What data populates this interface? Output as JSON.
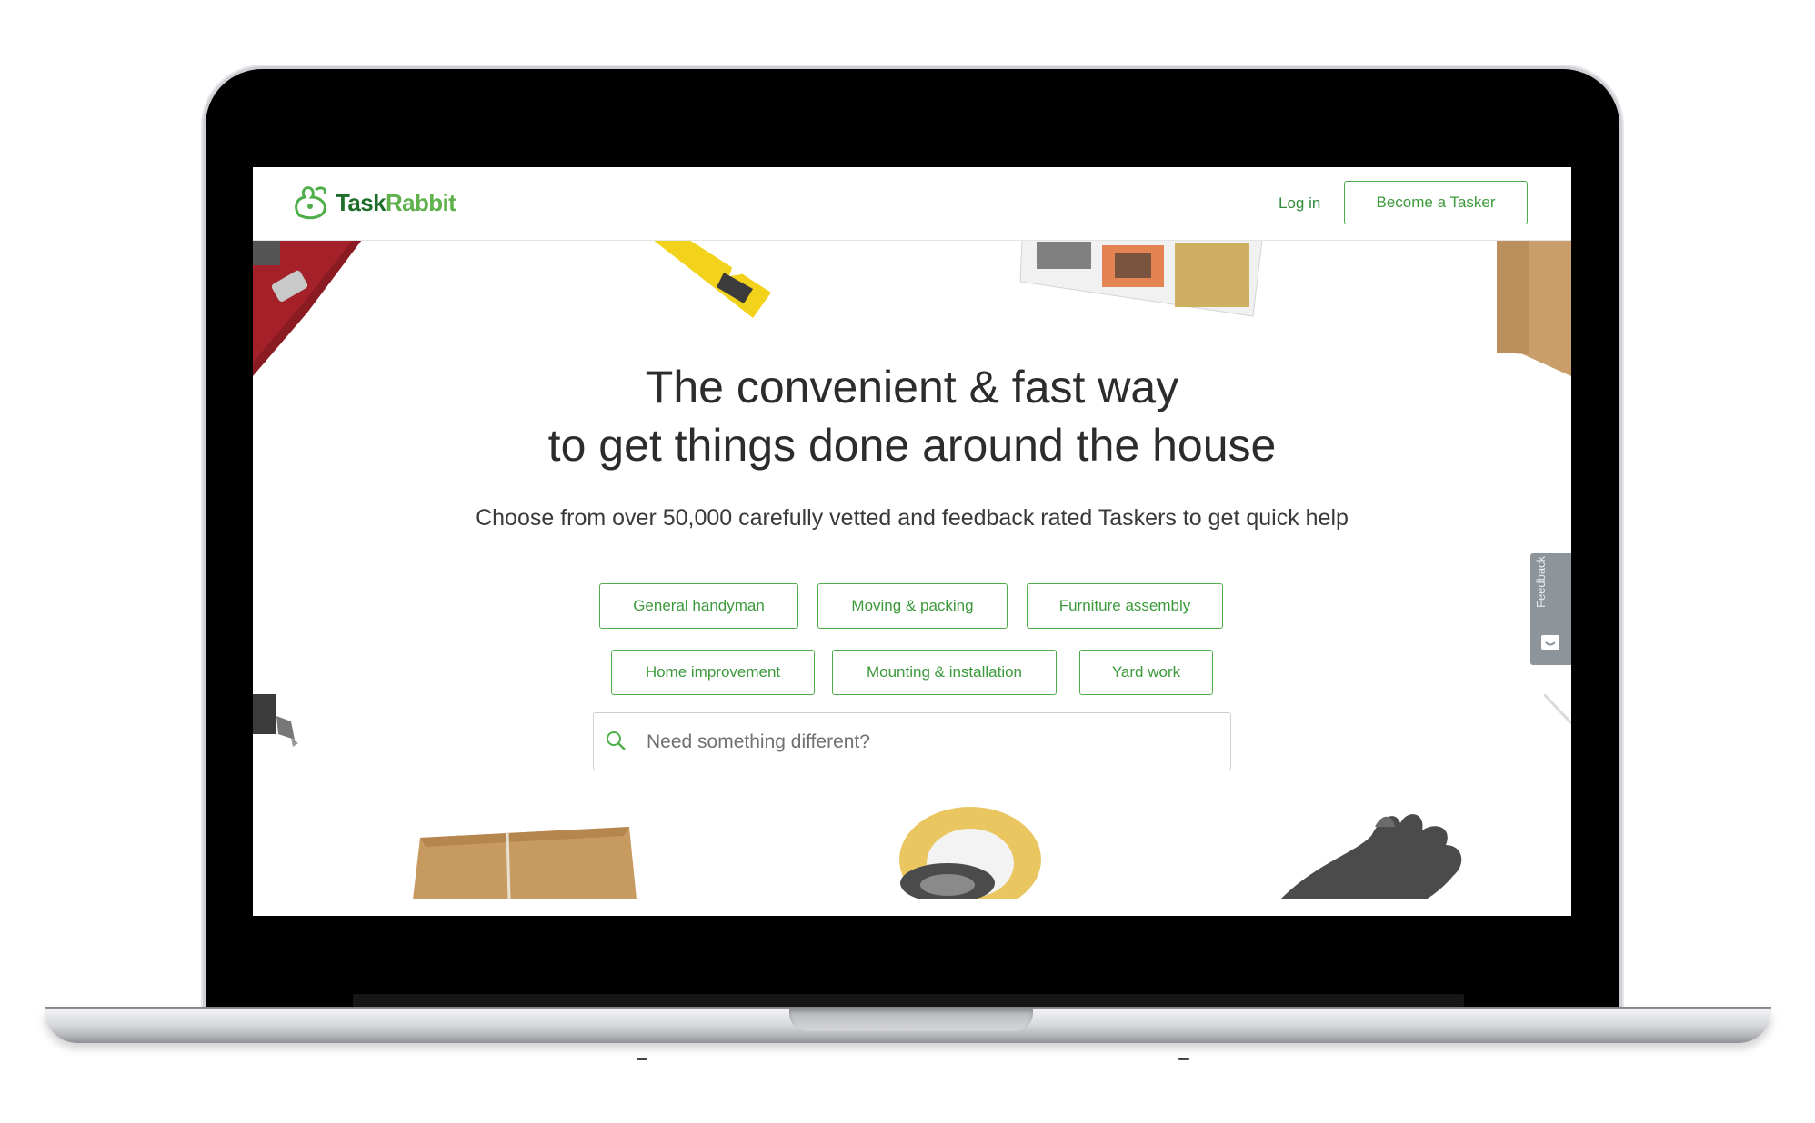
{
  "brand": {
    "logo_task": "Task",
    "logo_rabbit": "Rabbit",
    "green": "#4fae49",
    "dark_green": "#1f6d2a"
  },
  "nav": {
    "login": "Log in",
    "become_tasker": "Become a Tasker"
  },
  "hero": {
    "headline_line1": "The convenient & fast way",
    "headline_line2": "to get things done around the house",
    "subtitle": "Choose from over 50,000 carefully vetted and feedback rated Taskers to get quick help"
  },
  "categories": [
    "General handyman",
    "Moving & packing",
    "Furniture assembly",
    "Home improvement",
    "Mounting & installation",
    "Yard work"
  ],
  "search": {
    "placeholder": "Need something different?",
    "icon": "search-icon"
  },
  "feedback": {
    "label": "Feedback"
  }
}
